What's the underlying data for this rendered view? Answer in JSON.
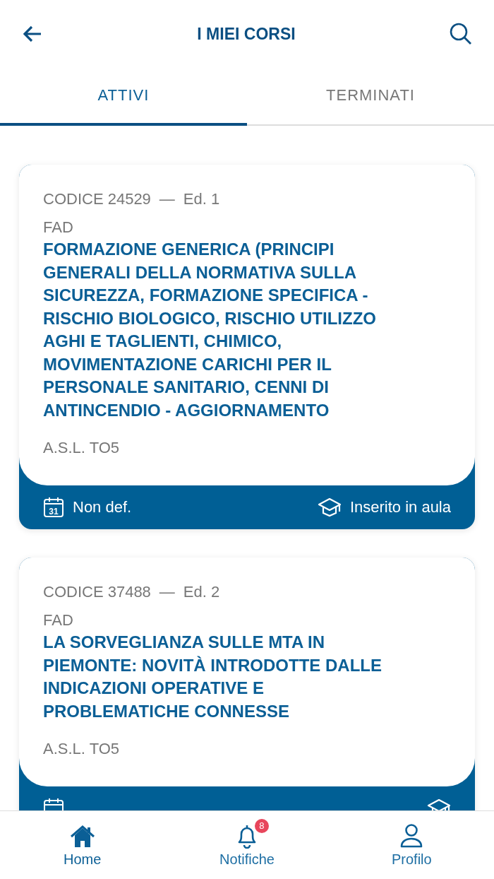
{
  "header": {
    "title": "I MIEI CORSI"
  },
  "tabs": [
    {
      "label": "ATTIVI",
      "selected": true
    },
    {
      "label": "TERMINATI",
      "selected": false
    }
  ],
  "courses": [
    {
      "code": "CODICE 24529",
      "separator": "—",
      "edition": "Ed. 1",
      "calendar_day": "31",
      "type": "FAD",
      "title": "FORMAZIONE GENERICA (PRINCIPI GENERALI DELLA NORMATIVA SULLA SICUREZZA, FORMAZIONE SPECIFICA - RISCHIO BIOLOGICO, RISCHIO UTILIZZO AGHI E TAGLIENTI, CHIMICO, MOVIMENTAZIONE CARICHI PER IL PERSONALE SANITARIO, CENNI DI ANTINCENDIO - AGGIORNAMENTO",
      "organization": "A.S.L. TO5",
      "date": "Non def.",
      "status": "Inserito in aula"
    },
    {
      "code": "CODICE 37488",
      "separator": "—",
      "edition": "Ed. 2",
      "type": "FAD",
      "title": "LA SORVEGLIANZA SULLE MTA IN PIEMONTE: NOVITÀ INTRODOTTE DALLE INDICAZIONI OPERATIVE E PROBLEMATICHE CONNESSE",
      "organization": "A.S.L. TO5"
    }
  ],
  "nav": [
    {
      "kind": "home",
      "label": "Home",
      "selected": true
    },
    {
      "kind": "bell",
      "label": "Notifiche",
      "selected": false,
      "badge": "8"
    },
    {
      "kind": "user",
      "label": "Profilo",
      "selected": false
    }
  ]
}
